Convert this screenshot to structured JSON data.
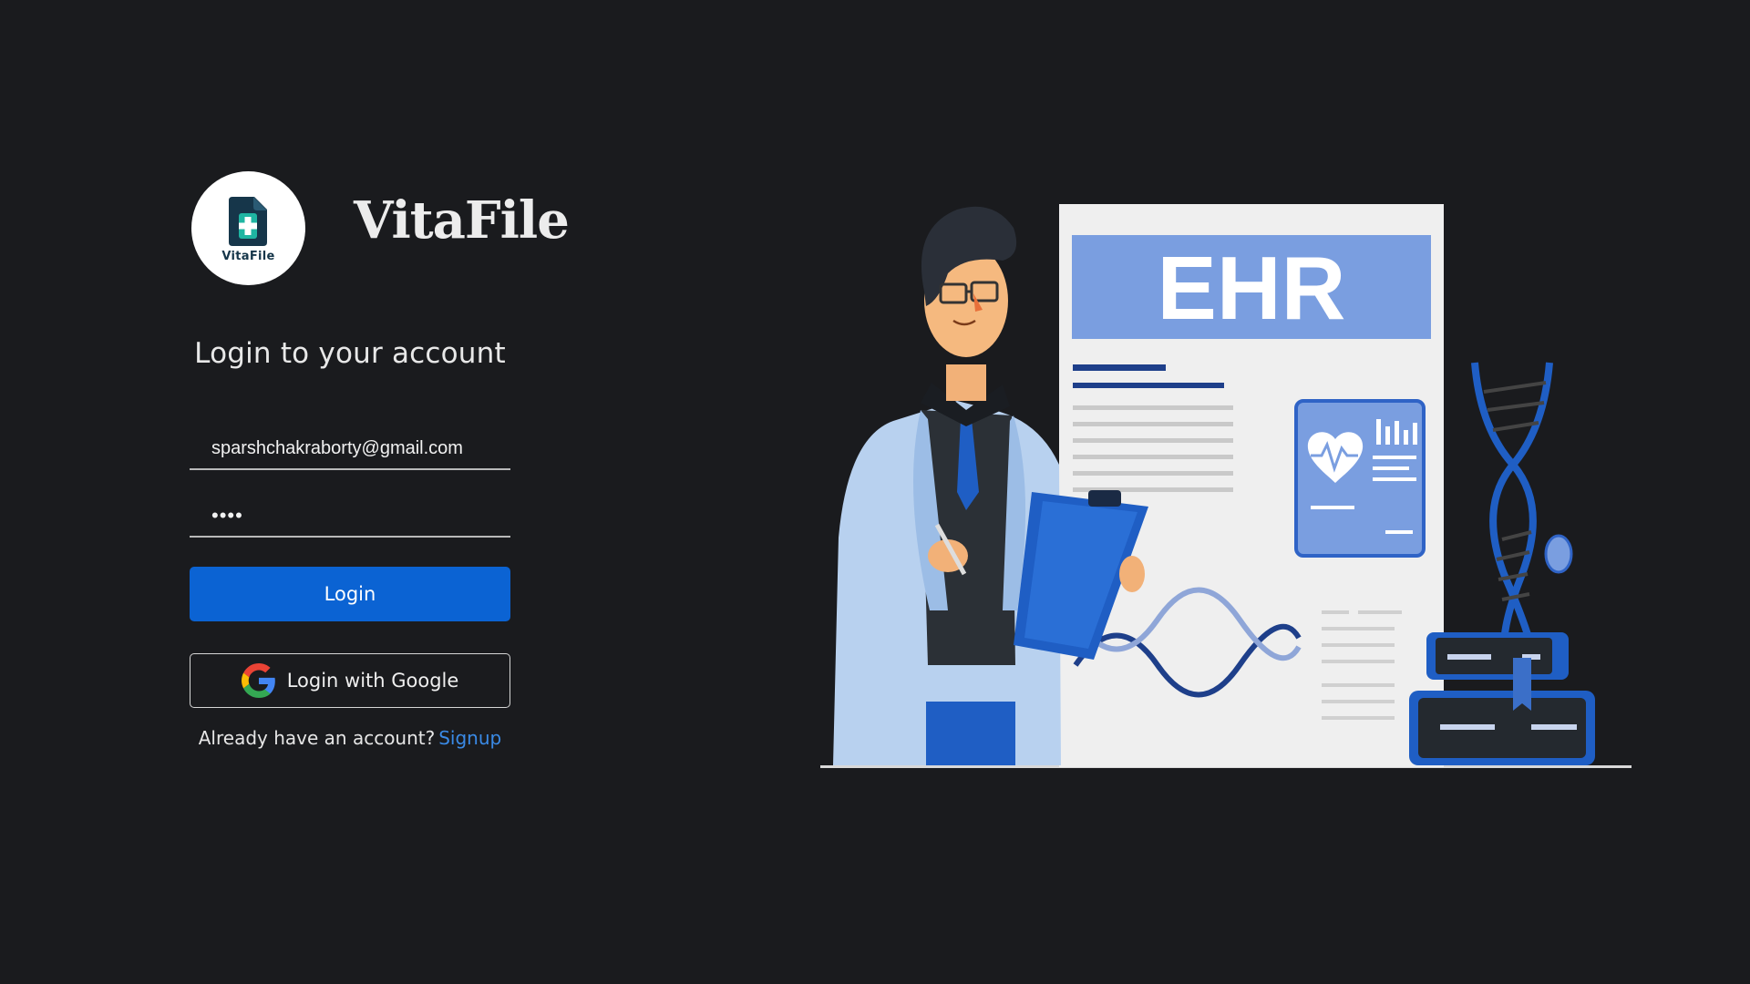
{
  "brand": {
    "name": "VitaFile",
    "logo_caption": "VitaFile",
    "logo_icon": "medical-file-plus-icon"
  },
  "login": {
    "heading": "Login to your account",
    "email_value": "sparshchakraborty@gmail.com",
    "password_value": "••••",
    "login_button": "Login",
    "google_button": "Login with Google",
    "google_icon": "google-g-icon",
    "signup_prompt": "Already have an account?",
    "signup_link": "Signup"
  },
  "illustration": {
    "board_text": "EHR",
    "icons": [
      "doctor-illustration",
      "heart-monitor-icon",
      "dna-icon",
      "clipboard-icon",
      "books-icon"
    ]
  },
  "colors": {
    "background": "#1a1b1e",
    "accent": "#0b63d3",
    "link": "#3a8ae6",
    "ehr_banner": "#7a9ee0"
  }
}
